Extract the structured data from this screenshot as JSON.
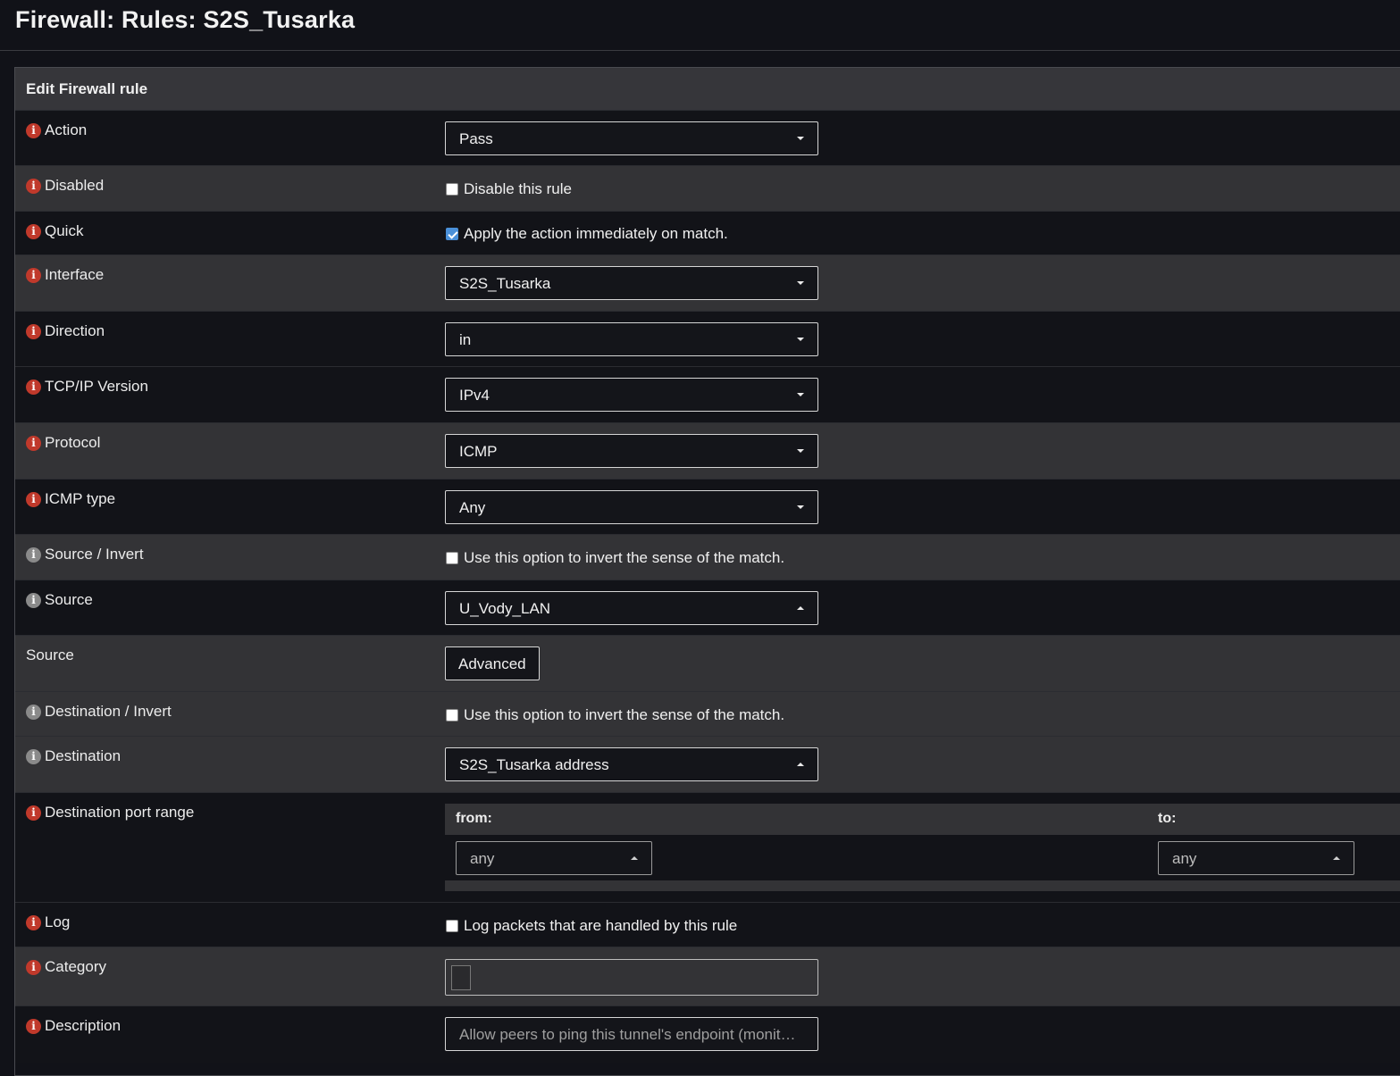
{
  "page": {
    "title": "Firewall: Rules: S2S_Tusarka"
  },
  "panel": {
    "heading": "Edit Firewall rule"
  },
  "fields": {
    "action": {
      "label": "Action",
      "value": "Pass"
    },
    "disabled": {
      "label": "Disabled",
      "checkbox_label": "Disable this rule",
      "checked": false
    },
    "quick": {
      "label": "Quick",
      "checkbox_label": "Apply the action immediately on match.",
      "checked": true
    },
    "interface": {
      "label": "Interface",
      "value": "S2S_Tusarka"
    },
    "direction": {
      "label": "Direction",
      "value": "in"
    },
    "tcpip_version": {
      "label": "TCP/IP Version",
      "value": "IPv4"
    },
    "protocol": {
      "label": "Protocol",
      "value": "ICMP"
    },
    "icmp_type": {
      "label": "ICMP type",
      "value": "Any"
    },
    "source_invert": {
      "label": "Source / Invert",
      "checkbox_label": "Use this option to invert the sense of the match.",
      "checked": false
    },
    "source": {
      "label": "Source",
      "value": "U_Vody_LAN"
    },
    "source_advanced": {
      "label": "Source",
      "button_label": "Advanced"
    },
    "destination_invert": {
      "label": "Destination / Invert",
      "checkbox_label": "Use this option to invert the sense of the match.",
      "checked": false
    },
    "destination": {
      "label": "Destination",
      "value": "S2S_Tusarka address"
    },
    "dest_port_range": {
      "label": "Destination port range",
      "from_label": "from:",
      "to_label": "to:",
      "from_value": "any",
      "to_value": "any"
    },
    "log": {
      "label": "Log",
      "checkbox_label": "Log packets that are handled by this rule",
      "checked": false
    },
    "category": {
      "label": "Category",
      "value": ""
    },
    "description": {
      "label": "Description",
      "value": "Allow peers to ping this tunnel's endpoint (monit…"
    }
  },
  "icons": {
    "info": "i"
  },
  "colors": {
    "info_red": "#c0392b",
    "info_grey": "#8a8a8a",
    "checkbox_checked": "#4a90d9"
  }
}
